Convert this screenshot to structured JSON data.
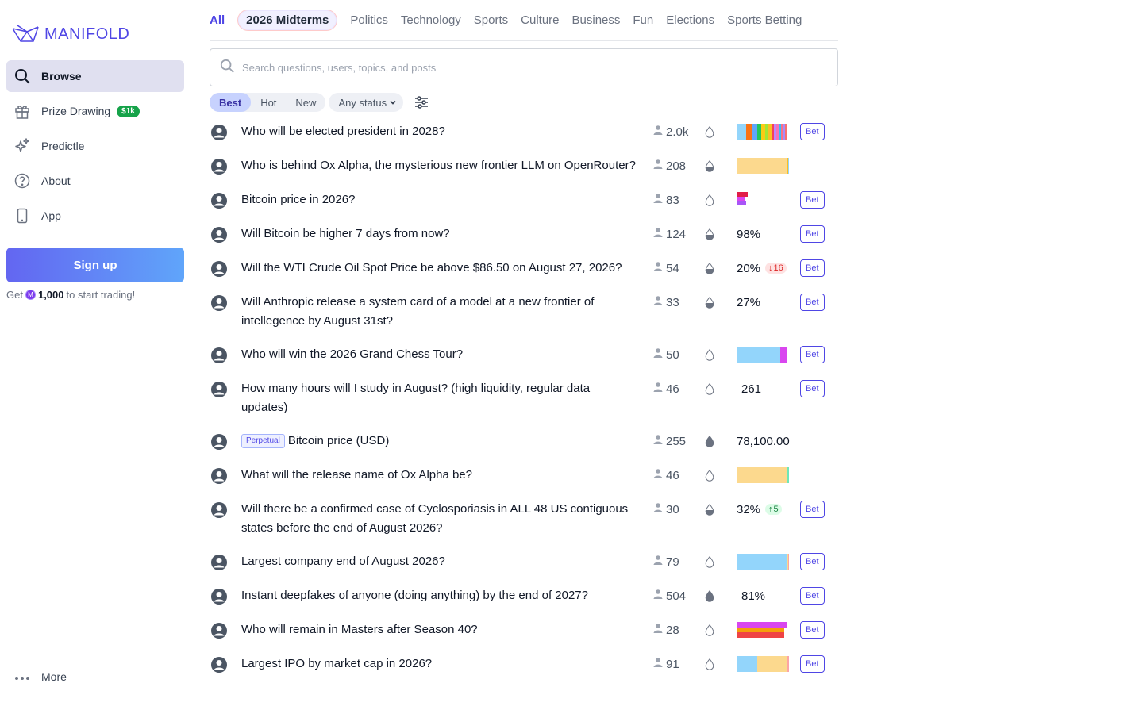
{
  "brand": {
    "name": "MANIFOLD",
    "color": "#4f46e5"
  },
  "sidebar": {
    "items": [
      {
        "label": "Browse",
        "icon": "search-icon",
        "active": true
      },
      {
        "label": "Prize Drawing",
        "icon": "gift-icon",
        "badge": "$1k"
      },
      {
        "label": "Predictle",
        "icon": "sparkles-icon"
      },
      {
        "label": "About",
        "icon": "question-circle-icon"
      },
      {
        "label": "App",
        "icon": "phone-icon"
      }
    ],
    "signup_label": "Sign up",
    "note_pre": "Get",
    "note_amount": "1,000",
    "note_post": "to start trading!",
    "more_label": "More"
  },
  "topics": [
    "All",
    "2026 Midterms",
    "Politics",
    "Technology",
    "Sports",
    "Culture",
    "Business",
    "Fun",
    "Elections",
    "Sports Betting"
  ],
  "search": {
    "placeholder": "Search questions, users, topics, and posts"
  },
  "filters": {
    "sorts": [
      "Best",
      "Hot",
      "New"
    ],
    "status": "Any status"
  },
  "markets": [
    {
      "q": "Who will be elected president in 2028?",
      "traders": "2.0k",
      "liq": "low",
      "type": "multi",
      "bars": [
        [
          "#93d5fb",
          12
        ],
        [
          "#f97316",
          8
        ],
        [
          "#60a5fa",
          6
        ],
        [
          "#22c55e",
          5
        ],
        [
          "#facc15",
          5
        ],
        [
          "#a3e635",
          4
        ],
        [
          "#fbbf24",
          4
        ],
        [
          "#f43f5e",
          3
        ],
        [
          "#c084fc",
          3
        ],
        [
          "#f472b6",
          3
        ],
        [
          "#38bdf8",
          3
        ],
        [
          "#fb7185",
          3
        ],
        [
          "#a78bfa",
          2
        ],
        [
          "#f87171",
          2
        ]
      ],
      "bet": "Bet"
    },
    {
      "q": "Who is behind Ox Alpha, the mysterious new frontier LLM on OpenRouter?",
      "traders": "208",
      "liq": "half",
      "type": "multi",
      "bars": [
        [
          "#fcd98e",
          64
        ],
        [
          "#fbbf24",
          1
        ],
        [
          "#93d5fb",
          1
        ]
      ]
    },
    {
      "q": "Bitcoin price in 2026?",
      "traders": "83",
      "liq": "low",
      "type": "stack",
      "stack": [
        [
          "#e11d48",
          14,
          6
        ],
        [
          "#d946ef",
          10,
          5
        ],
        [
          "#a855f7",
          12,
          5
        ]
      ],
      "bet": "Bet"
    },
    {
      "q": "Will Bitcoin be higher 7 days from now?",
      "traders": "124",
      "liq": "half",
      "type": "prob",
      "prob": "98%",
      "bet": "Bet"
    },
    {
      "q": "Will the WTI Crude Oil Spot Price be above $86.50 on August 27, 2026?",
      "traders": "54",
      "liq": "half",
      "type": "prob",
      "prob": "20%",
      "delta": "16",
      "delta_dir": "down",
      "bet": "Bet"
    },
    {
      "q": "Will Anthropic release a system card of a model at a new frontier of intellegence by August 31st?",
      "traders": "33",
      "liq": "half",
      "type": "prob",
      "prob": "27%",
      "bet": "Bet"
    },
    {
      "q": "Who will win the 2026 Grand Chess Tour?",
      "traders": "50",
      "liq": "low",
      "type": "multi",
      "bars": [
        [
          "#93d5fb",
          55
        ],
        [
          "#d946ef",
          9
        ],
        [
          "#ffffff",
          2
        ]
      ],
      "bet": "Bet"
    },
    {
      "q": "How many hours will I study in August? (high liquidity, regular data updates)",
      "traders": "46",
      "liq": "low",
      "type": "prob",
      "prob": "261",
      "indent": true,
      "bet": "Bet"
    },
    {
      "q": "Bitcoin price (USD)",
      "perpetual": "Perpetual",
      "traders": "255",
      "liq": "full",
      "type": "prob",
      "prob": "78,100.00"
    },
    {
      "q": "What will the release name of Ox Alpha be?",
      "traders": "46",
      "liq": "low",
      "type": "multi",
      "bars": [
        [
          "#fcd98e",
          64
        ],
        [
          "#6ee7b7",
          2
        ]
      ]
    },
    {
      "q": "Will there be a confirmed case of Cyclosporiasis in ALL 48 US contiguous states before the end of August 2026?",
      "traders": "30",
      "liq": "half",
      "type": "prob",
      "prob": "32%",
      "delta": "5",
      "delta_dir": "up",
      "bet": "Bet"
    },
    {
      "q": "Largest company end of August 2026?",
      "traders": "79",
      "liq": "low",
      "type": "multi",
      "bars": [
        [
          "#93d5fb",
          63
        ],
        [
          "#fcd98e",
          2
        ],
        [
          "#fca5a5",
          1
        ]
      ],
      "bet": "Bet"
    },
    {
      "q": "Instant deepfakes of anyone (doing anything) by the end of 2027?",
      "traders": "504",
      "liq": "full",
      "type": "prob",
      "prob": "81%",
      "indent": true,
      "bet": "Bet"
    },
    {
      "q": "Who will remain in Masters after Season 40?",
      "traders": "28",
      "liq": "low",
      "type": "stack",
      "stack": [
        [
          "#d946ef",
          63,
          7
        ],
        [
          "#f59e0b",
          60,
          6
        ],
        [
          "#ef4444",
          60,
          7
        ]
      ],
      "bet": "Bet"
    },
    {
      "q": "Largest IPO by market cap in 2026?",
      "traders": "91",
      "liq": "low",
      "type": "multi",
      "bars": [
        [
          "#93d5fb",
          26
        ],
        [
          "#fcd98e",
          38
        ],
        [
          "#fca5a5",
          2
        ]
      ],
      "bet": "Bet"
    }
  ]
}
